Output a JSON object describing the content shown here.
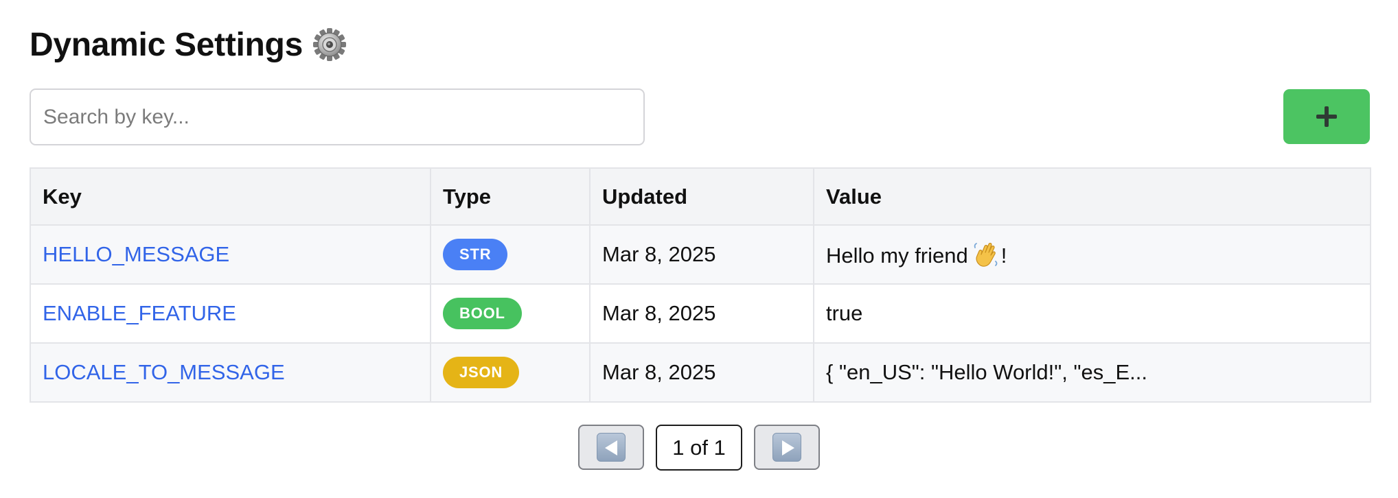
{
  "header": {
    "title": "Dynamic Settings",
    "title_icon": "gear-icon"
  },
  "search": {
    "placeholder": "Search by key...",
    "value": ""
  },
  "toolbar": {
    "add_icon": "plus-icon",
    "add_color": "#4cc462"
  },
  "table": {
    "columns": [
      "Key",
      "Type",
      "Updated",
      "Value"
    ],
    "rows": [
      {
        "key": "HELLO_MESSAGE",
        "type": "STR",
        "type_color": "#4a80f5",
        "updated": "Mar 8, 2025",
        "value_before": "Hello my friend",
        "value_icon": "waving-hand-icon",
        "value_after": "!"
      },
      {
        "key": "ENABLE_FEATURE",
        "type": "BOOL",
        "type_color": "#47c25f",
        "updated": "Mar 8, 2025",
        "value_before": "true",
        "value_icon": "",
        "value_after": ""
      },
      {
        "key": "LOCALE_TO_MESSAGE",
        "type": "JSON",
        "type_color": "#e5b416",
        "updated": "Mar 8, 2025",
        "value_before": "{ \"en_US\": \"Hello World!\", \"es_E...",
        "value_icon": "",
        "value_after": ""
      }
    ]
  },
  "pagination": {
    "indicator": "1 of 1",
    "prev_icon": "arrow-left-icon",
    "next_icon": "arrow-right-icon"
  },
  "colors": {
    "link": "#3164e8",
    "header_bg": "#f3f4f6"
  }
}
